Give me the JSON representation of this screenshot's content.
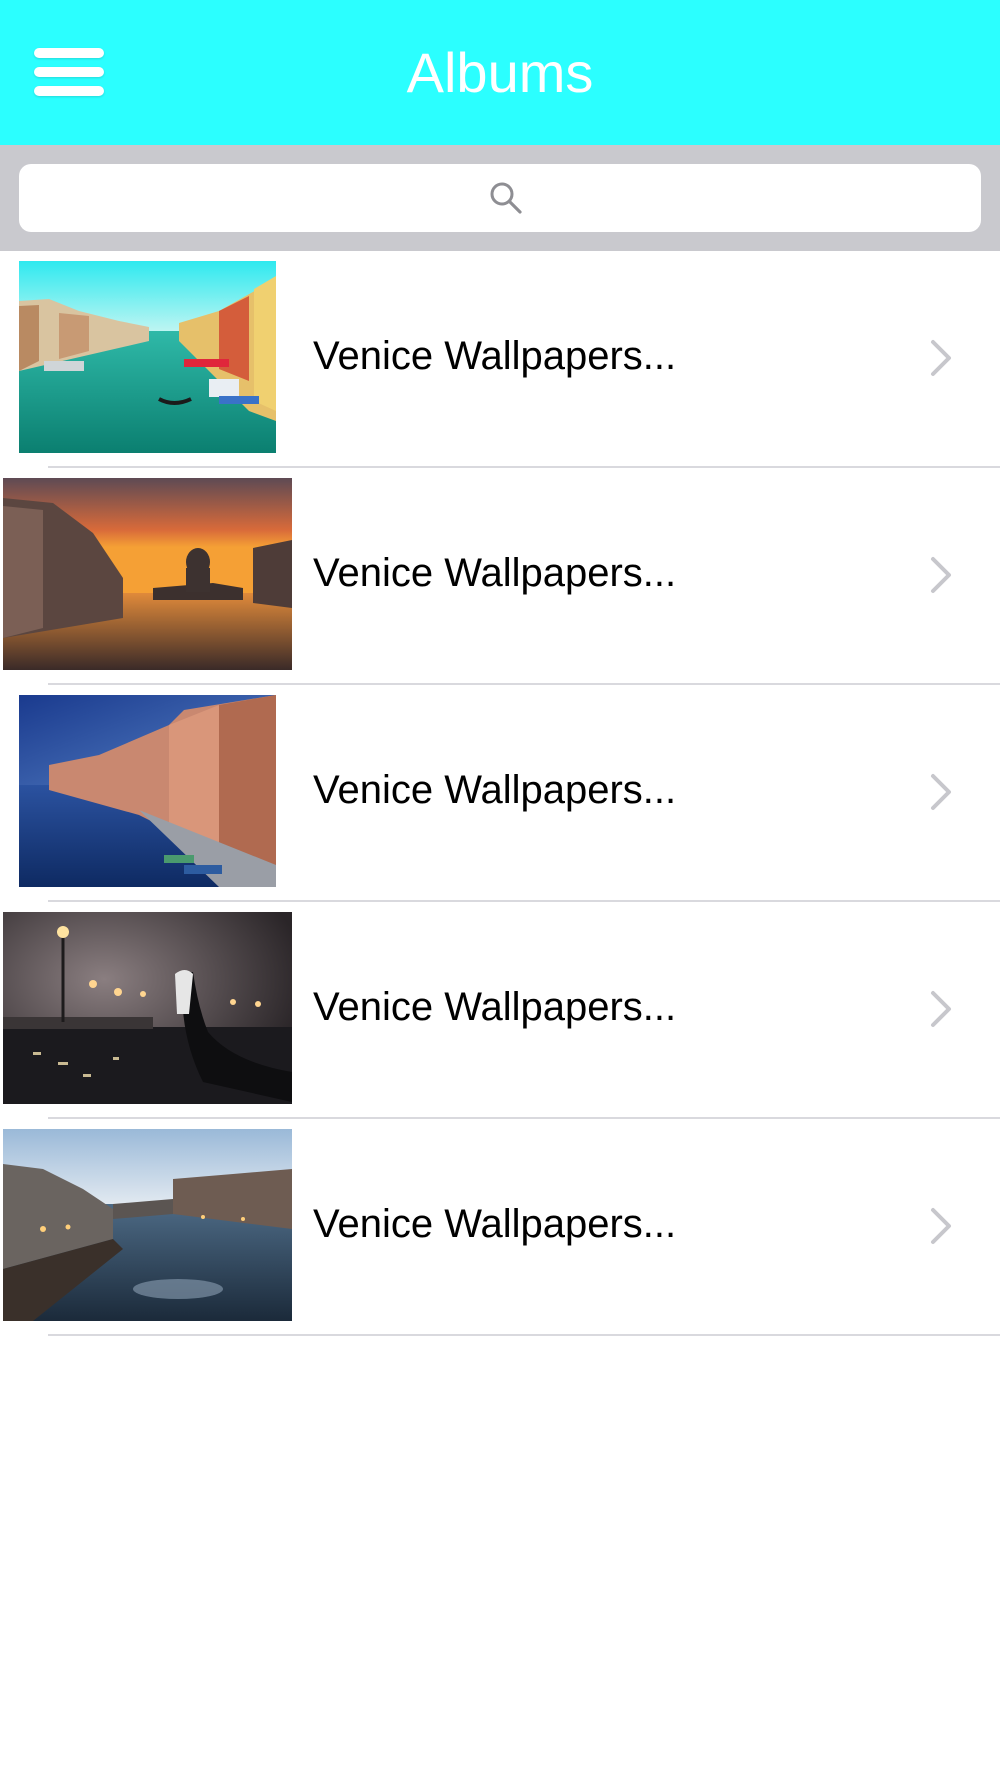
{
  "navbar": {
    "title": "Albums",
    "background": "#2bffff",
    "menu_icon": "hamburger-menu-icon"
  },
  "search": {
    "placeholder": "",
    "icon": "search-icon"
  },
  "albums": [
    {
      "label": "Venice Wallpapers...",
      "thumbnail": "grand-canal-daytime"
    },
    {
      "label": "Venice Wallpapers...",
      "thumbnail": "grand-canal-sunset"
    },
    {
      "label": "Venice Wallpapers...",
      "thumbnail": "canal-blue-evening"
    },
    {
      "label": "Venice Wallpapers...",
      "thumbnail": "gondola-foggy-night"
    },
    {
      "label": "Venice Wallpapers...",
      "thumbnail": "canal-dusk-long-exposure"
    }
  ]
}
